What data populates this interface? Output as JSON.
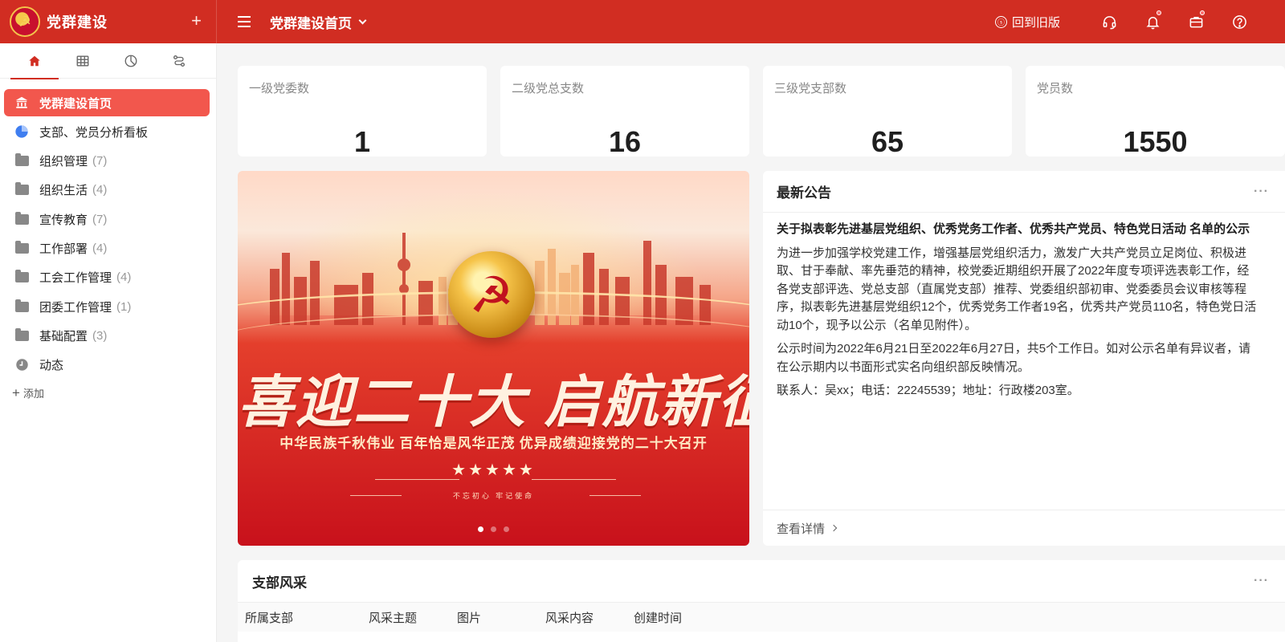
{
  "header": {
    "brand": "党群建设",
    "add_label": "+",
    "page_title": "党群建设首页",
    "old_version": "回到旧版",
    "old_version_icon": "ⓢ"
  },
  "sidebar": {
    "tabs": [
      "home-icon",
      "table-icon",
      "chart-icon",
      "flow-icon"
    ],
    "items": [
      {
        "label": "党群建设首页",
        "count": ""
      },
      {
        "label": "支部、党员分析看板",
        "count": ""
      },
      {
        "label": "组织管理",
        "count": "(7)"
      },
      {
        "label": "组织生活",
        "count": "(4)"
      },
      {
        "label": "宣传教育",
        "count": "(7)"
      },
      {
        "label": "工作部署",
        "count": "(4)"
      },
      {
        "label": "工会工作管理",
        "count": "(4)"
      },
      {
        "label": "团委工作管理",
        "count": "(1)"
      },
      {
        "label": "基础配置",
        "count": "(3)"
      },
      {
        "label": "动态",
        "count": ""
      }
    ],
    "add_label": "添加"
  },
  "stats": [
    {
      "label": "一级党委数",
      "value": "1"
    },
    {
      "label": "二级党总支数",
      "value": "16"
    },
    {
      "label": "三级党支部数",
      "value": "65"
    },
    {
      "label": "党员数",
      "value": "1550"
    }
  ],
  "banner": {
    "headline": "喜迎二十大 启航新征程",
    "subline": "中华民族千秋伟业 百年恰是风华正茂 优异成绩迎接党的二十大召开",
    "motto": "不忘初心 牢记使命",
    "stars": "★★★★★",
    "active_slide": 1,
    "slide_count": 3
  },
  "notice": {
    "title": "最新公告",
    "more": "···",
    "headline": "关于拟表彰先进基层党组织、优秀党务工作者、优秀共产党员、特色党日活动 名单的公示",
    "paragraphs": [
      "为进一步加强学校党建工作，增强基层党组织活力，激发广大共产党员立足岗位、积极进取、甘于奉献、率先垂范的精神，校党委近期组织开展了2022年度专项评选表彰工作，经各党支部评选、党总支部（直属党支部）推荐、党委组织部初审、党委委员会议审核等程序，拟表彰先进基层党组织12个，优秀党务工作者19名，优秀共产党员110名，特色党日活动10个，现予以公示（名单见附件）。",
      "公示时间为2022年6月21日至2022年6月27日，共5个工作日。如对公示名单有异议者，请在公示期内以书面形式实名向组织部反映情况。",
      "联系人：吴xx；电话：22245539；地址：行政楼203室。"
    ],
    "detail_link": "查看详情"
  },
  "branch": {
    "title": "支部风采",
    "more": "···",
    "columns": [
      "所属支部",
      "风采主题",
      "图片",
      "风采内容",
      "创建时间"
    ]
  },
  "colors": {
    "primary": "#d12d22",
    "active_nav": "#f2574d"
  }
}
